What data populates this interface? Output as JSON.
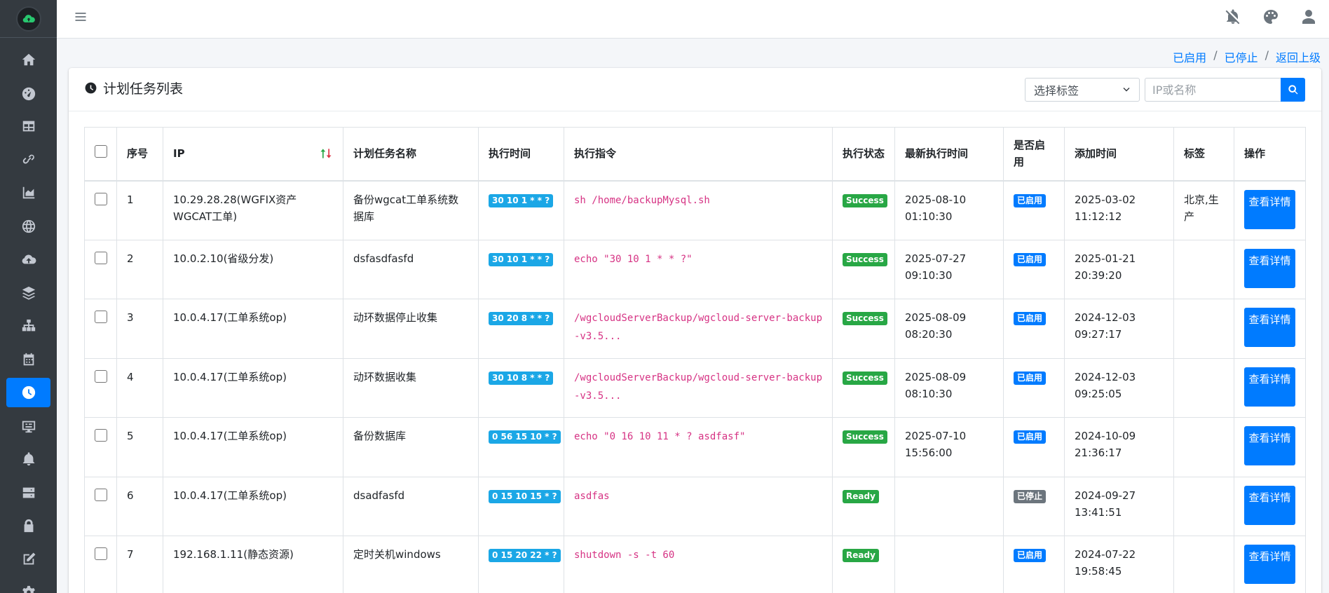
{
  "header": {
    "icons": [
      "menu-icon",
      "bell-slash-icon",
      "palette-icon",
      "user-icon"
    ]
  },
  "breadcrumb": {
    "enabled": "已启用",
    "stopped": "已停止",
    "back": "返回上级",
    "sep": "/"
  },
  "card": {
    "title": "计划任务列表",
    "tag_select": "选择标签",
    "search_placeholder": "IP或名称"
  },
  "table": {
    "headers": [
      "序号",
      "IP",
      "计划任务名称",
      "执行时间",
      "执行指令",
      "执行状态",
      "最新执行时间",
      "是否启用",
      "添加时间",
      "标签",
      "操作"
    ],
    "rows": [
      {
        "no": "1",
        "ip": "10.29.28.28(WGFIX资产WGCAT工单)",
        "name": "备份wgcat工单系统数据库",
        "cron": "30 10 1 * * ?",
        "cmd": "sh /home/backupMysql.sh",
        "status": "Success",
        "last": "2025-08-10 01:10:30",
        "enabled": "已启用",
        "added": "2025-03-02 11:12:12",
        "tag": "北京,生产",
        "action": "查看详情"
      },
      {
        "no": "2",
        "ip": "10.0.2.10(省级分发)",
        "name": "dsfasdfasfd",
        "cron": "30 10 1 * * ?",
        "cmd": "echo \"30 10 1 * * ?\"",
        "status": "Success",
        "last": "2025-07-27 09:10:30",
        "enabled": "已启用",
        "added": "2025-01-21 20:39:20",
        "tag": "",
        "action": "查看详情"
      },
      {
        "no": "3",
        "ip": "10.0.4.17(工单系统op)",
        "name": "动环数据停止收集",
        "cron": "30 20 8 * * ?",
        "cmd": "/wgcloudServerBackup/wgcloud-server-backup-v3.5...",
        "status": "Success",
        "last": "2025-08-09 08:20:30",
        "enabled": "已启用",
        "added": "2024-12-03 09:27:17",
        "tag": "",
        "action": "查看详情"
      },
      {
        "no": "4",
        "ip": "10.0.4.17(工单系统op)",
        "name": "动环数据收集",
        "cron": "30 10 8 * * ?",
        "cmd": "/wgcloudServerBackup/wgcloud-server-backup-v3.5...",
        "status": "Success",
        "last": "2025-08-09 08:10:30",
        "enabled": "已启用",
        "added": "2024-12-03 09:25:05",
        "tag": "",
        "action": "查看详情"
      },
      {
        "no": "5",
        "ip": "10.0.4.17(工单系统op)",
        "name": "备份数据库",
        "cron": "0 56 15 10 * ?",
        "cmd": "echo \"0 16 10 11 * ? asdfasf\"",
        "status": "Success",
        "last": "2025-07-10 15:56:00",
        "enabled": "已启用",
        "added": "2024-10-09 21:36:17",
        "tag": "",
        "action": "查看详情"
      },
      {
        "no": "6",
        "ip": "10.0.4.17(工单系统op)",
        "name": "dsadfasfd",
        "cron": "0 15 10 15 * ?",
        "cmd": "asdfas",
        "status": "Ready",
        "last": "",
        "enabled": "已停止",
        "added": "2024-09-27 13:41:51",
        "tag": "",
        "action": "查看详情"
      },
      {
        "no": "7",
        "ip": "192.168.1.11(静态资源)",
        "name": "定时关机windows",
        "cron": "0 15 20 22 * ?",
        "cmd": "shutdown -s -t 60",
        "status": "Ready",
        "last": "",
        "enabled": "已启用",
        "added": "2024-07-22 19:58:45",
        "tag": "",
        "action": "查看详情"
      }
    ]
  },
  "sidebar": {
    "items": [
      "home-icon",
      "dashboard-icon",
      "table-icon",
      "link-icon",
      "chart-area-icon",
      "globe-icon",
      "cloud-upload-icon",
      "layers-icon",
      "sitemap-icon",
      "calendar-icon",
      "clock-icon",
      "terminal-icon",
      "bell-icon",
      "server-icon",
      "lock-icon",
      "edit-icon",
      "cog-icon"
    ],
    "active_index": 10
  },
  "colors": {
    "primary": "#007bff",
    "success": "#28a745",
    "secondary": "#6c757d",
    "cron_badge": "#1ba7e6",
    "sidebar": "#343a40",
    "cmd": "#d63384"
  }
}
